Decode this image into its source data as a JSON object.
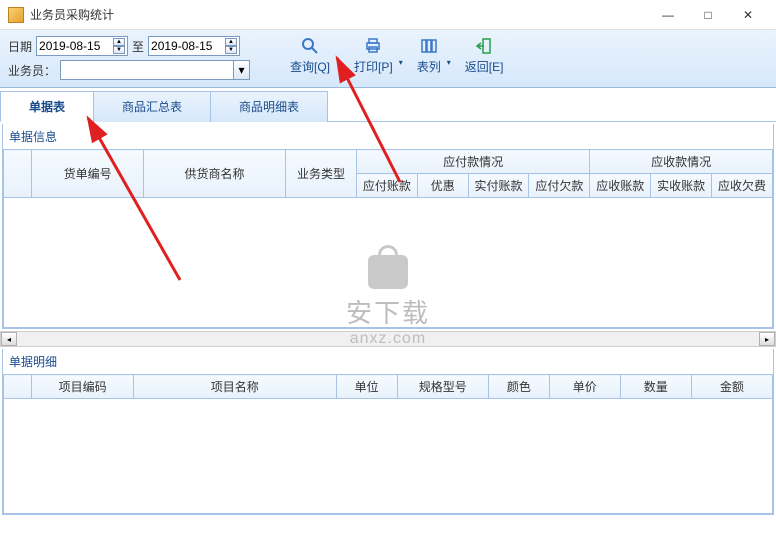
{
  "window": {
    "title": "业务员采购统计",
    "min": "—",
    "max": "□",
    "close": "✕"
  },
  "filters": {
    "date_label": "日期",
    "date_from": "2019-08-15",
    "date_to_label": "至",
    "date_to": "2019-08-15",
    "salesman_label": "业务员："
  },
  "toolbar": {
    "query": "查询[Q]",
    "print": "打印[P]",
    "columns": "表列",
    "back": "返回[E]"
  },
  "tabs": {
    "t1": "单据表",
    "t2": "商品汇总表",
    "t3": "商品明细表"
  },
  "section1": {
    "title": "单据信息",
    "headers": {
      "rowhandle": "",
      "bill_no": "货单编号",
      "supplier": "供货商名称",
      "btype": "业务类型",
      "payable_group": "应付款情况",
      "payable_acct": "应付账款",
      "discount": "优惠",
      "paid_acct": "实付账款",
      "payable_owe": "应付欠款",
      "receivable_group": "应收款情况",
      "receivable_acct": "应收账款",
      "received_acct": "实收账款",
      "receivable_owe": "应收欠费"
    }
  },
  "section2": {
    "title": "单据明细",
    "headers": {
      "rowhandle": "",
      "item_code": "项目编码",
      "item_name": "项目名称",
      "unit": "单位",
      "spec": "规格型号",
      "color": "颜色",
      "price": "单价",
      "qty": "数量",
      "amount": "金额"
    }
  },
  "watermark": {
    "cn": "安下载",
    "en": "anxz.com"
  }
}
